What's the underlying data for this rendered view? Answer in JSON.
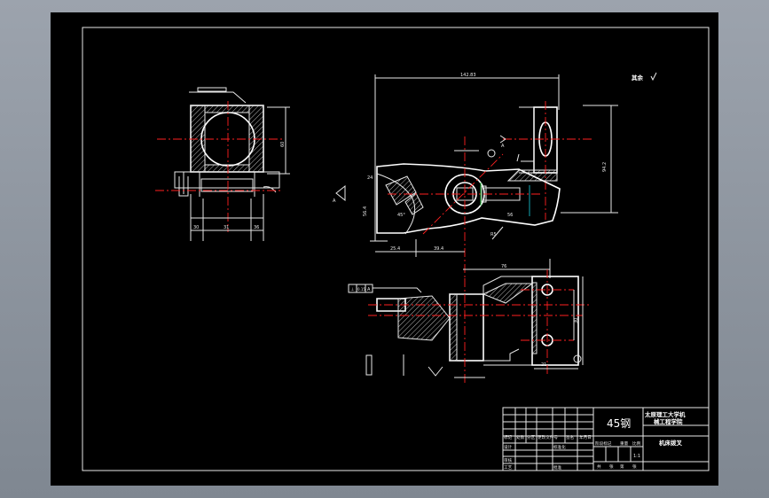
{
  "title_block": {
    "material": "45钢",
    "school_line1": "太原理工大学机",
    "school_line2": "械工程学院",
    "part_name": "机床拨叉",
    "header_row": [
      "标记",
      "处数",
      "分区",
      "更改文件号",
      "签名",
      "年月日"
    ],
    "row_design": "设计",
    "row_standardize": "标准化",
    "row_review": "审核",
    "row_process": "工艺",
    "row_approve": "批准",
    "stage_labels": [
      "阶段标记",
      "重量",
      "比例"
    ],
    "scale": "1:1",
    "sheet_labels": [
      "共",
      "张",
      "第",
      "张"
    ]
  },
  "surface_note": "其余",
  "dimensions": {
    "top_length": "142.83",
    "d_left_w1": "30",
    "d_left_w2": "31",
    "d_left_w3": "36",
    "d_left_h": "60",
    "d_bottom_a": "25.4",
    "d_bottom_b": "39.4",
    "d_side_len": "76",
    "d_side_a": "30",
    "d_side_b": "21",
    "d_angle": "45°",
    "d_h2": "24",
    "d_r": "R5",
    "d_v1": "56.4",
    "d_v2": "94.2",
    "d_v3": "56"
  },
  "section_label": "A",
  "tolerance_frame": [
    "⊥",
    "0.15",
    "A"
  ]
}
